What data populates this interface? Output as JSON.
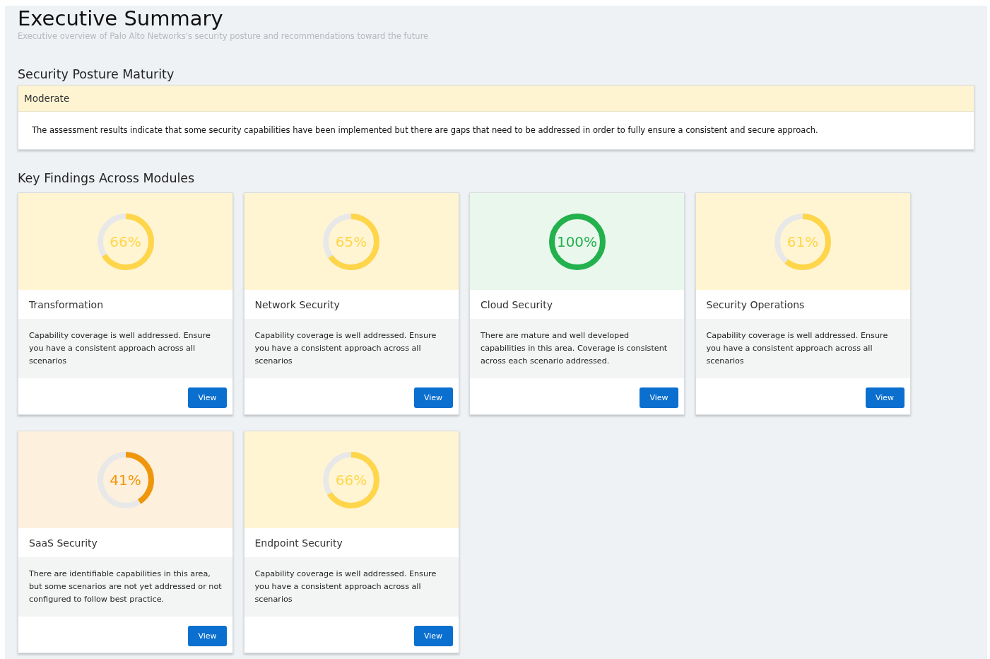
{
  "header": {
    "title": "Executive Summary",
    "subtitle": "Executive overview of Palo Alto Networks's security posture and recommendations toward the future"
  },
  "maturity": {
    "heading": "Security Posture Maturity",
    "level_label": "Moderate",
    "description": "The assessment results indicate that some security capabilities have been implemented but there are gaps that need to be addressed in order to fully ensure a consistent and secure approach."
  },
  "findings": {
    "heading": "Key Findings Across Modules",
    "cards": [
      {
        "title": "Transformation",
        "percent": "66%",
        "level": 0.66,
        "color": "#ffd54a",
        "description": "Capability coverage is well addressed. Ensure you have a consistent approach across all scenarios",
        "button": "View"
      },
      {
        "title": "Network Security",
        "percent": "65%",
        "level": 0.65,
        "color": "#ffd54a",
        "description": "Capability coverage is well addressed. Ensure you have a consistent approach across all scenarios",
        "button": "View"
      },
      {
        "title": "Cloud Security",
        "percent": "100%",
        "level": 1,
        "color": "#22b14c",
        "description": "There are mature and well developed capabilities in this area. Coverage is consistent across each scenario addressed.",
        "button": "View"
      },
      {
        "title": "Security Operations",
        "percent": "61%",
        "level": 0.61,
        "color": "#ffd54a",
        "description": "Capability coverage is well addressed. Ensure you have a consistent approach across all scenarios",
        "button": "View"
      },
      {
        "title": "SaaS Security",
        "percent": "41%",
        "level": 0.41,
        "color": "#f0960a",
        "description": "There are identifiable capabilities in this area, but some scenarios are not yet addressed or not configured to follow best practice.",
        "button": "View"
      },
      {
        "title": "Endpoint Security",
        "percent": "66%",
        "level": 0.66,
        "color": "#ffd54a",
        "description": "Capability coverage is well addressed. Ensure you have a consistent approach across all scenarios",
        "button": "View"
      }
    ]
  }
}
